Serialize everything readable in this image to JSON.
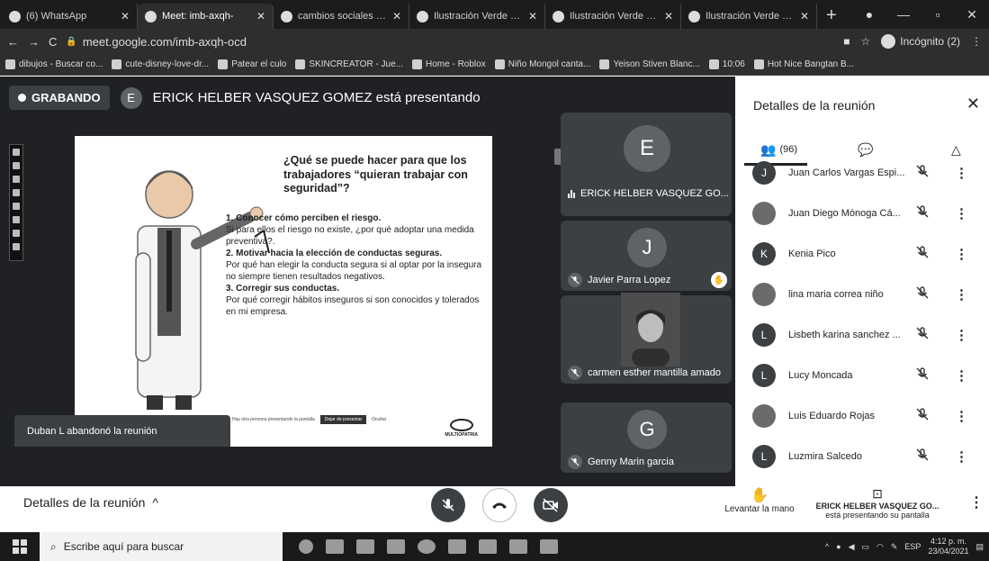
{
  "browser": {
    "tabs": [
      {
        "title": "(6) WhatsApp",
        "active": false
      },
      {
        "title": "Meet: imb-axqh-",
        "active": true
      },
      {
        "title": "cambios sociales Gru",
        "active": false
      },
      {
        "title": "Ilustración Verde Día",
        "active": false
      },
      {
        "title": "Ilustración Verde Día",
        "active": false
      },
      {
        "title": "Ilustración Verde Día",
        "active": false
      }
    ],
    "url": "meet.google.com/imb-axqh-ocd",
    "incognito_label": "Incógnito (2)",
    "bookmarks": [
      "dibujos - Buscar co...",
      "cute-disney-love-dr...",
      "Patear el culo",
      "SKINCREATOR - Jue...",
      "Home - Roblox",
      "Niño Mongol canta...",
      "Yeison Stiven Blanc...",
      "10:06",
      "Hot Nice Bangtan B..."
    ]
  },
  "meet": {
    "recording_label": "GRABANDO",
    "presenter_initial": "E",
    "presenter_text": "ERICK HELBER VASQUEZ GOMEZ está presentando",
    "toast": "Duban L abandonó la reunión",
    "slide": {
      "title": "¿Qué se puede hacer para que los trabajadores “quieran trabajar con seguridad”?",
      "items": [
        {
          "heading": "1. Conocer cómo perciben el riesgo.",
          "text": "Si para ellos el riesgo no existe, ¿por qué adoptar una medida preventiva?."
        },
        {
          "heading": "2. Motivar hacia la elección de conductas seguras.",
          "text": "Por qué han elegir la conducta segura si al optar por la insegura no siempre tienen resultados negativos."
        },
        {
          "heading": "3. Corregir sus conductas.",
          "text": "Por qué corregir hábitos inseguros si son conocidos y tolerados en mi empresa."
        }
      ],
      "footer_text": "Hay otra persona presentando la pantalla",
      "footer_button": "Dejar de presentar",
      "footer_link": "Ocultar",
      "logo_text": "MULTIOPATRIA"
    },
    "tiles": [
      {
        "initial": "E",
        "name": "ERICK HELBER VASQUEZ GO...",
        "muted": false
      },
      {
        "initial": "J",
        "name": "Javier Parra Lopez",
        "muted": true
      },
      {
        "initial": "",
        "name": "carmen esther mantilla amado",
        "muted": true
      },
      {
        "initial": "G",
        "name": "Genny Marin garcia",
        "muted": true
      }
    ]
  },
  "panel": {
    "title": "Detalles de la reunión",
    "participant_count": "(96)",
    "participants": [
      {
        "initial": "J",
        "name": "Juan Carlos Vargas Espi...",
        "photo": false
      },
      {
        "initial": "",
        "name": "Juan Diego Mónoga Cá...",
        "photo": true
      },
      {
        "initial": "K",
        "name": "Kenia Pico",
        "photo": false
      },
      {
        "initial": "",
        "name": "lina maria correa niño",
        "photo": true
      },
      {
        "initial": "L",
        "name": "Lisbeth karina sanchez ...",
        "photo": false
      },
      {
        "initial": "L",
        "name": "Lucy Moncada",
        "photo": false
      },
      {
        "initial": "",
        "name": "Luis Eduardo Rojas",
        "photo": true
      },
      {
        "initial": "L",
        "name": "Luzmira Salcedo",
        "photo": false
      }
    ]
  },
  "bottombar": {
    "details_label": "Detalles de la reunión",
    "raise_hand_label": "Levantar la mano",
    "presenting_name": "ERICK HELBER VASQUEZ GO...",
    "presenting_sub": "está presentando su pantalla"
  },
  "taskbar": {
    "search_placeholder": "Escribe aquí para buscar",
    "lang": "ESP",
    "time": "4:12 p. m.",
    "date": "23/04/2021"
  }
}
